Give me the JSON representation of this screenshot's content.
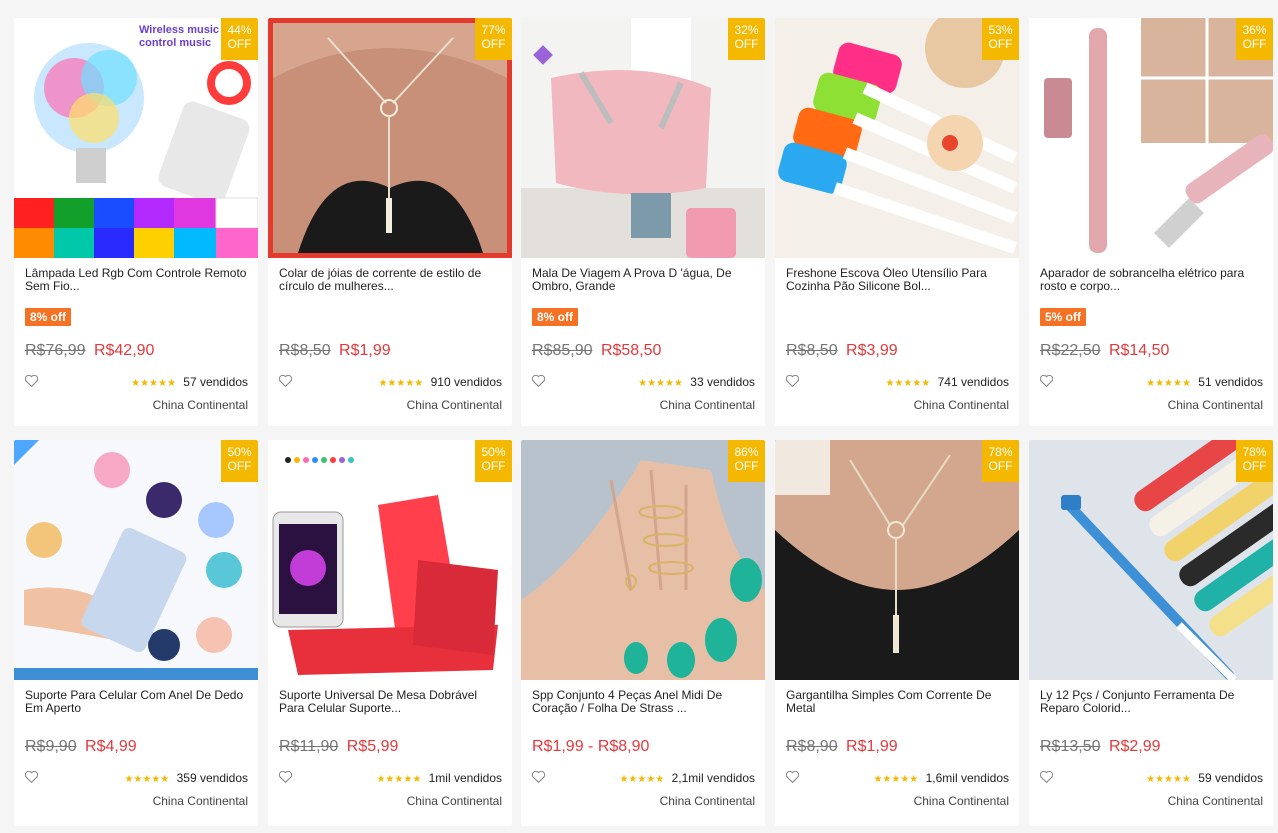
{
  "products": [
    {
      "discount_pct": "44%",
      "discount_label": "OFF",
      "title": "Lâmpada Led Rgb Com Controle Remoto Sem Fio...",
      "off_tag": "8% off",
      "old_price": "R$76,99",
      "price": "R$42,90",
      "sold": "57 vendidos",
      "origin": "China Continental",
      "image_text": "Wireless music control music"
    },
    {
      "discount_pct": "77%",
      "discount_label": "OFF",
      "title": "Colar de jóias de corrente de estilo de círculo de mulheres...",
      "off_tag": "",
      "old_price": "R$8,50",
      "price": "R$1,99",
      "sold": "910 vendidos",
      "origin": "China Continental"
    },
    {
      "discount_pct": "32%",
      "discount_label": "OFF",
      "title": "Mala De Viagem A Prova D 'água, De Ombro, Grande",
      "off_tag": "8% off",
      "old_price": "R$85,90",
      "price": "R$58,50",
      "sold": "33 vendidos",
      "origin": "China Continental"
    },
    {
      "discount_pct": "53%",
      "discount_label": "OFF",
      "title": "Freshone Escova Óleo Utensílio Para Cozinha Pão Silicone Bol...",
      "off_tag": "",
      "old_price": "R$8,50",
      "price": "R$3,99",
      "sold": "741 vendidos",
      "origin": "China Continental"
    },
    {
      "discount_pct": "36%",
      "discount_label": "OFF",
      "title": "Aparador de sobrancelha elétrico para rosto e corpo...",
      "off_tag": "5% off",
      "old_price": "R$22,50",
      "price": "R$14,50",
      "sold": "51 vendidos",
      "origin": "China Continental"
    },
    {
      "discount_pct": "50%",
      "discount_label": "OFF",
      "title": "Suporte Para Celular Com Anel De Dedo Em Aperto",
      "off_tag": "",
      "old_price": "R$9,90",
      "price": "R$4,99",
      "sold": "359 vendidos",
      "origin": "China Continental"
    },
    {
      "discount_pct": "50%",
      "discount_label": "OFF",
      "title": "Suporte Universal De Mesa Dobrável Para Celular Suporte...",
      "off_tag": "",
      "old_price": "R$11,90",
      "price": "R$5,99",
      "sold": "1mil vendidos",
      "origin": "China Continental"
    },
    {
      "discount_pct": "86%",
      "discount_label": "OFF",
      "title": "Spp Conjunto 4 Peças Anel Midi De Coração / Folha De Strass ...",
      "off_tag": "",
      "old_price": "",
      "price": "R$1,99 - R$8,90",
      "sold": "2,1mil vendidos",
      "origin": "China Continental"
    },
    {
      "discount_pct": "78%",
      "discount_label": "OFF",
      "title": "Gargantilha Simples Com Corrente De Metal",
      "off_tag": "",
      "old_price": "R$8,90",
      "price": "R$1,99",
      "sold": "1,6mil vendidos",
      "origin": "China Continental"
    },
    {
      "discount_pct": "78%",
      "discount_label": "OFF",
      "title": "Ly 12 Pçs / Conjunto Ferramenta De Reparo Colorid...",
      "off_tag": "",
      "old_price": "R$13,50",
      "price": "R$2,99",
      "sold": "59 vendidos",
      "origin": "China Continental"
    }
  ],
  "colors": {
    "accent": "#e4393c",
    "badge": "#f5b800",
    "off_tag": "#f57224",
    "stars": "#f5b800"
  },
  "icons": {
    "heart": "heart-icon",
    "star": "star-icon"
  },
  "rating_stars": "★★★★★"
}
